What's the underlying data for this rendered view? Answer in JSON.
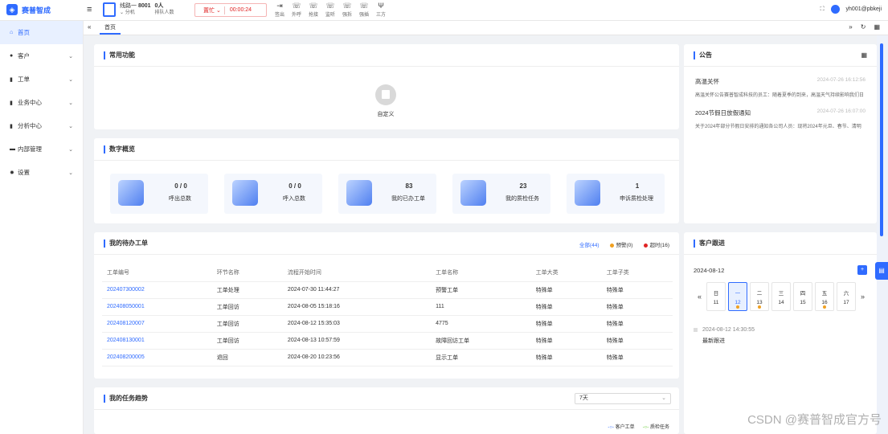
{
  "app": {
    "brand": "赛普智成"
  },
  "agent": {
    "line": "线路一",
    "ext": "8001",
    "ext_label": "分机",
    "queue": "0人",
    "queue_label": "排队人数"
  },
  "status": {
    "state": "置忙",
    "timer": "00:00:24"
  },
  "controls": [
    {
      "icon": "logout-icon",
      "glyph": "⇥",
      "label": "签出"
    },
    {
      "icon": "phone-out-icon",
      "glyph": "☏",
      "label": "外呼"
    },
    {
      "icon": "phone-grab-icon",
      "glyph": "☏",
      "label": "抢接"
    },
    {
      "icon": "phone-monitor-icon",
      "glyph": "☏",
      "label": "监听"
    },
    {
      "icon": "phone-intercept-icon",
      "glyph": "☏",
      "label": "强拆"
    },
    {
      "icon": "phone-insert-icon",
      "glyph": "☏",
      "label": "强插"
    },
    {
      "icon": "three-way-icon",
      "glyph": "Ψ",
      "label": "三方"
    }
  ],
  "user": {
    "name": "yh001@pbkeji"
  },
  "sidebar": [
    {
      "label": "首页",
      "icon": "home-icon",
      "glyph": "⌂",
      "active": true,
      "chevron": false
    },
    {
      "label": "客户",
      "icon": "customer-icon",
      "glyph": "●",
      "active": false,
      "chevron": true
    },
    {
      "label": "工单",
      "icon": "ticket-icon",
      "glyph": "▮",
      "active": false,
      "chevron": true
    },
    {
      "label": "业务中心",
      "icon": "business-icon",
      "glyph": "▮",
      "active": false,
      "chevron": true
    },
    {
      "label": "分析中心",
      "icon": "analysis-icon",
      "glyph": "▮",
      "active": false,
      "chevron": true
    },
    {
      "label": "内部管理",
      "icon": "internal-icon",
      "glyph": "▬",
      "active": false,
      "chevron": true
    },
    {
      "label": "设置",
      "icon": "settings-icon",
      "glyph": "✹",
      "active": false,
      "chevron": true
    }
  ],
  "tabs": {
    "home": "首页"
  },
  "common": {
    "title": "常用功能",
    "custom": "自定义"
  },
  "overview": {
    "title": "数字概览",
    "stats": [
      {
        "value": "0 / 0",
        "label": "呼出总数"
      },
      {
        "value": "0 / 0",
        "label": "呼入总数"
      },
      {
        "value": "83",
        "label": "我的已办工单"
      },
      {
        "value": "23",
        "label": "我的质检任务"
      },
      {
        "value": "1",
        "label": "申诉质检处理"
      }
    ]
  },
  "todo": {
    "title": "我的待办工单",
    "filter_all": "全部(44)",
    "filter_warn": "预警(0)",
    "filter_timeout": "超时(16)",
    "columns": [
      "工单编号",
      "环节名称",
      "流程开始时间",
      "工单名称",
      "工单大类",
      "工单子类"
    ],
    "rows": [
      [
        "202407300002",
        "工单处理",
        "2024-07-30 11:44:27",
        "预警工单",
        "特殊单",
        "特殊单"
      ],
      [
        "202408050001",
        "工单回访",
        "2024-08-05 15:18:16",
        "111",
        "特殊单",
        "特殊单"
      ],
      [
        "202408120007",
        "工单回访",
        "2024-08-12 15:35:03",
        "4775",
        "特殊单",
        "特殊单"
      ],
      [
        "202408130001",
        "工单回访",
        "2024-08-13 10:57:59",
        "故障回访工单",
        "特殊单",
        "特殊单"
      ],
      [
        "202408200005",
        "退回",
        "2024-08-20 10:23:56",
        "显示工单",
        "特殊单",
        "特殊单"
      ]
    ]
  },
  "trend": {
    "title": "我的任务趋势",
    "range": "7天",
    "legend": [
      "客户工单",
      "质检任务"
    ]
  },
  "notice": {
    "title": "公告",
    "items": [
      {
        "title": "高温关怀",
        "time": "2024-07-26 16:12:56",
        "body": "高温关怀公告赛普智成科技的员工：随着夏季的到来，高温天气持续影响我们日"
      },
      {
        "title": "2024节假日放假通知",
        "time": "2024-07-26 16:07:00",
        "body": "关于2024年部分节假日安排的通知各公司人员：现将2024年元旦、春节、清明"
      }
    ]
  },
  "followup": {
    "title": "客户跟进",
    "date": "2024-08-12",
    "add": "+",
    "week": [
      {
        "dow": "日",
        "day": "11",
        "mark": false,
        "sel": false
      },
      {
        "dow": "一",
        "day": "12",
        "mark": true,
        "sel": true
      },
      {
        "dow": "二",
        "day": "13",
        "mark": true,
        "sel": false
      },
      {
        "dow": "三",
        "day": "14",
        "mark": false,
        "sel": false
      },
      {
        "dow": "四",
        "day": "15",
        "mark": false,
        "sel": false
      },
      {
        "dow": "五",
        "day": "16",
        "mark": true,
        "sel": false
      },
      {
        "dow": "六",
        "day": "17",
        "mark": false,
        "sel": false
      }
    ],
    "entry_time": "2024-08-12 14:30:55",
    "entry_text": "最新跟进"
  },
  "colors": {
    "accent": "#2f6bff",
    "danger": "#e02424",
    "warn": "#f0a020"
  },
  "watermark": "CSDN @赛普智成官方号"
}
